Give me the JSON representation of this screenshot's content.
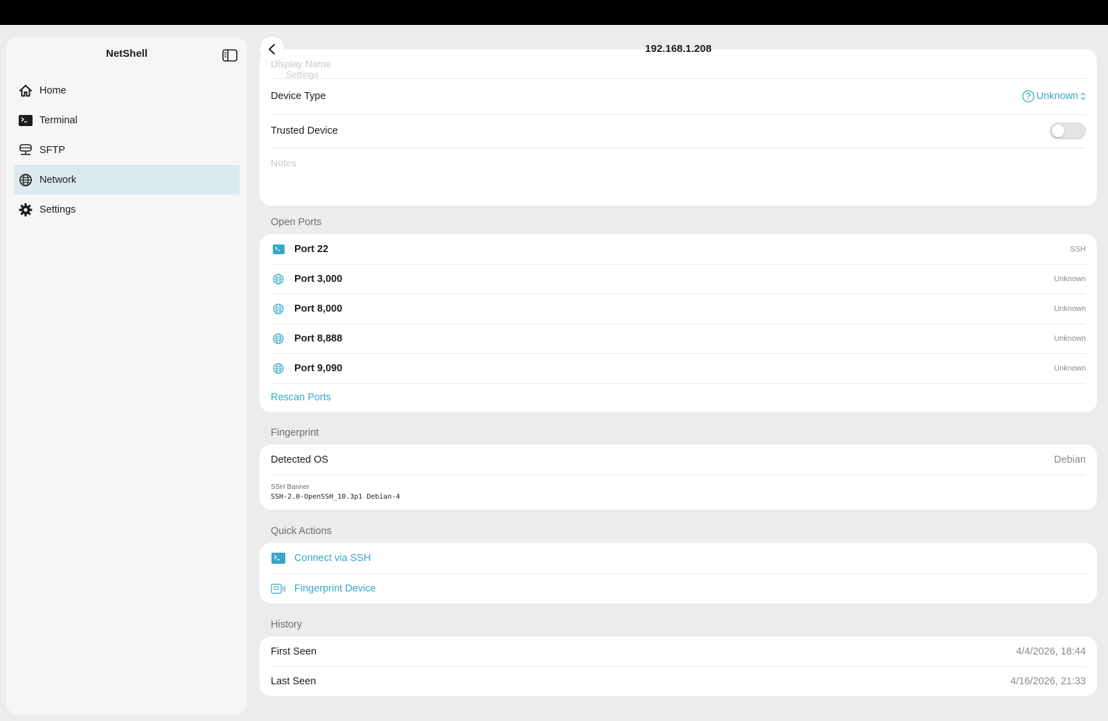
{
  "sidebar": {
    "title": "NetShell",
    "items": [
      {
        "label": "Home",
        "icon": "house-icon"
      },
      {
        "label": "Terminal",
        "icon": "terminal-icon"
      },
      {
        "label": "SFTP",
        "icon": "server-icon"
      },
      {
        "label": "Network",
        "icon": "globe-icon",
        "active": true
      },
      {
        "label": "Settings",
        "icon": "gear-icon"
      }
    ]
  },
  "header": {
    "title": "192.168.1.208",
    "faded_section": "Settings"
  },
  "details": {
    "display_name_placeholder": "Display Name",
    "device_type_label": "Device Type",
    "device_type_value": "Unknown",
    "trusted_label": "Trusted Device",
    "trusted_on": false,
    "notes_placeholder": "Notes"
  },
  "open_ports": {
    "title": "Open Ports",
    "ports": [
      {
        "label": "Port 22",
        "service": "SSH",
        "icon": "terminal-icon"
      },
      {
        "label": "Port 3,000",
        "service": "Unknown",
        "icon": "globe-icon"
      },
      {
        "label": "Port 8,000",
        "service": "Unknown",
        "icon": "globe-icon"
      },
      {
        "label": "Port 8,888",
        "service": "Unknown",
        "icon": "globe-icon"
      },
      {
        "label": "Port 9,090",
        "service": "Unknown",
        "icon": "globe-icon"
      }
    ],
    "rescan_label": "Rescan Ports"
  },
  "fingerprint": {
    "title": "Fingerprint",
    "os_label": "Detected OS",
    "os_value": "Debian",
    "banner_label": "SSH Banner",
    "banner_value": "SSH-2.0-OpenSSH_10.3p1 Debian-4"
  },
  "quick_actions": {
    "title": "Quick Actions",
    "connect_label": "Connect via SSH",
    "fingerprint_label": "Fingerprint Device"
  },
  "history": {
    "title": "History",
    "first_seen_label": "First Seen",
    "first_seen_value": "4/4/2026, 18:44",
    "last_seen_label": "Last Seen",
    "last_seen_value": "4/16/2026, 21:33"
  },
  "colors": {
    "accent": "#35a7c8",
    "active_nav": "#dde9f0"
  }
}
